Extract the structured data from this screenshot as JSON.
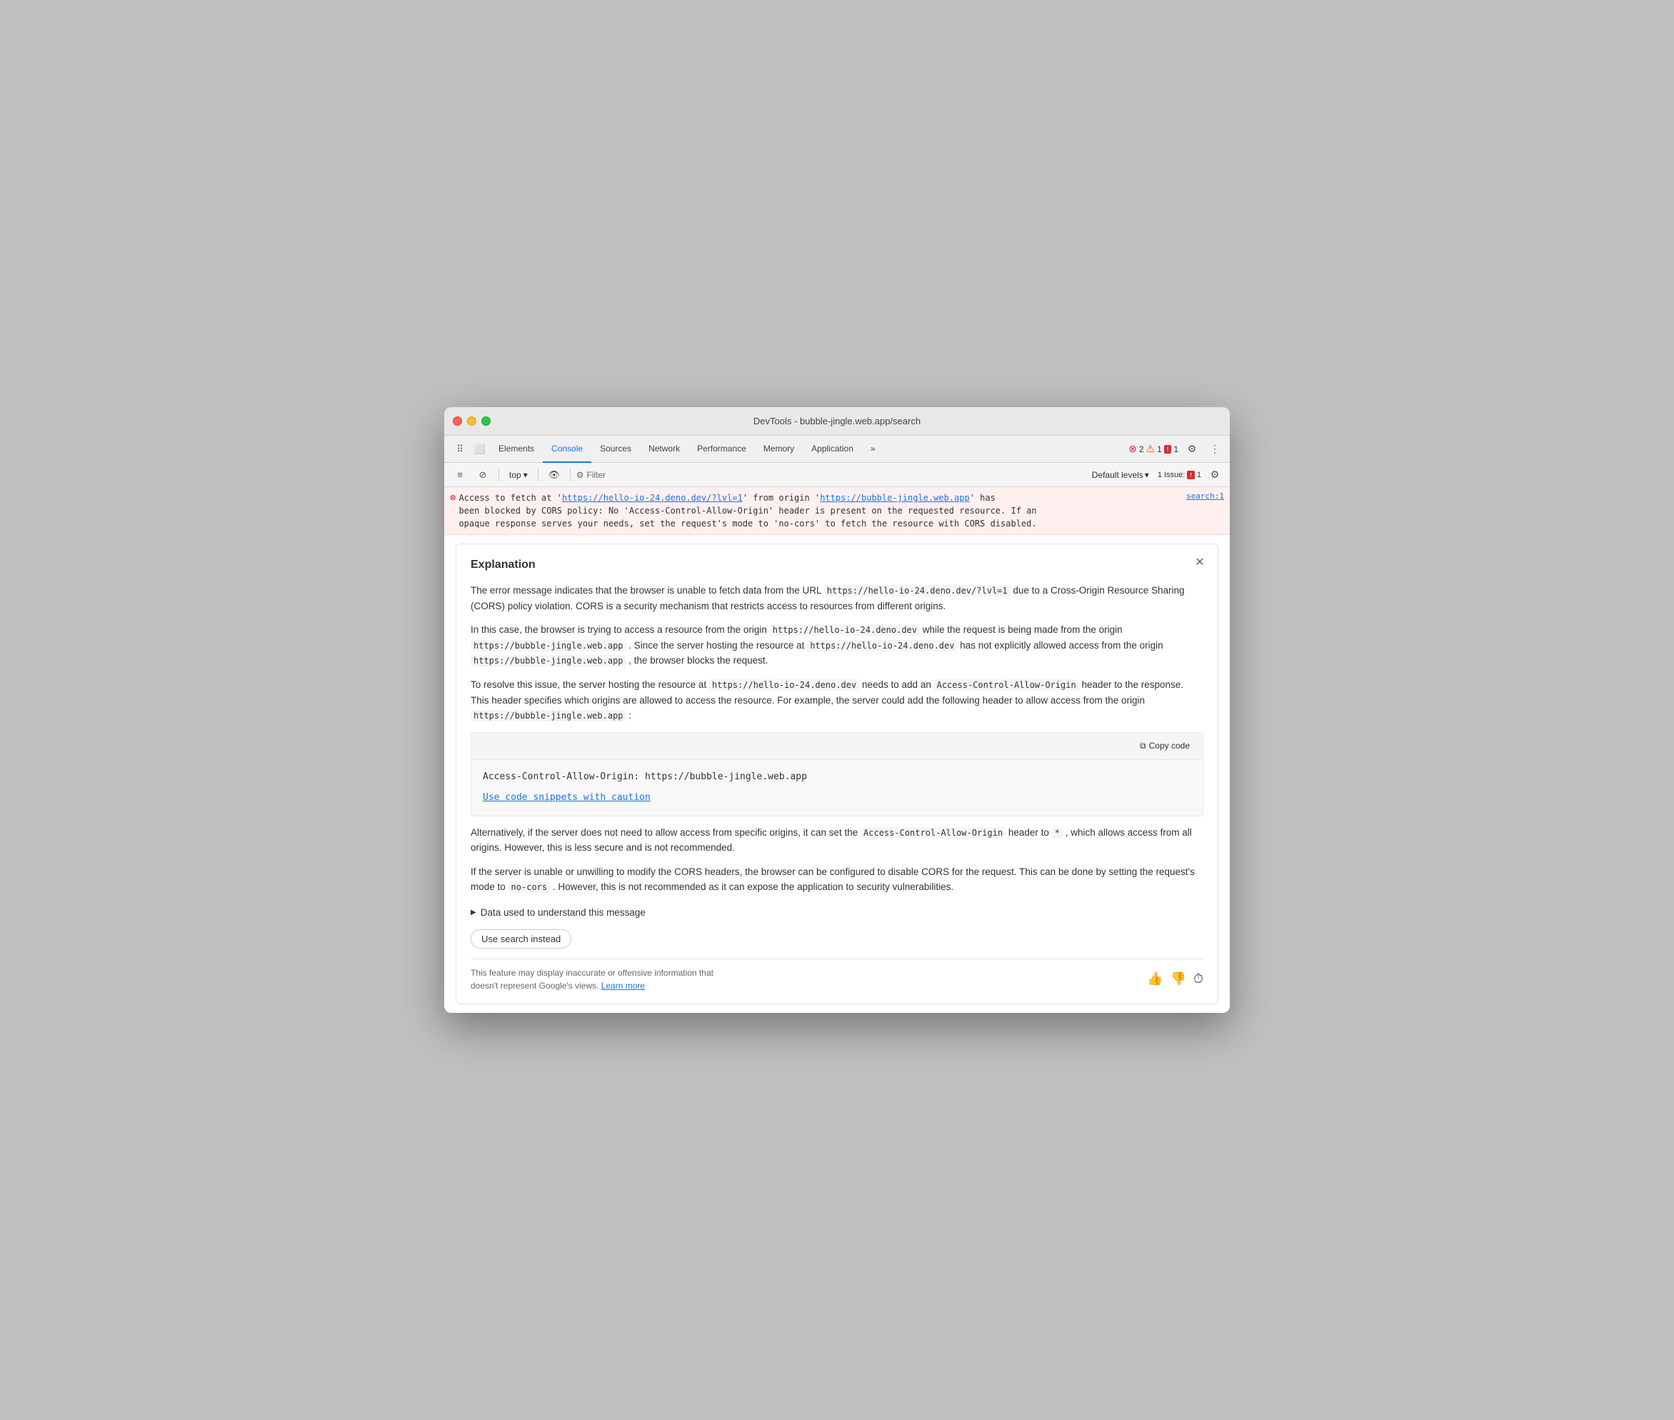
{
  "titlebar": {
    "title": "DevTools - bubble-jingle.web.app/search"
  },
  "tabs": {
    "items": [
      {
        "label": "Elements",
        "active": false
      },
      {
        "label": "Console",
        "active": true
      },
      {
        "label": "Sources",
        "active": false
      },
      {
        "label": "Network",
        "active": false
      },
      {
        "label": "Performance",
        "active": false
      },
      {
        "label": "Memory",
        "active": false
      },
      {
        "label": "Application",
        "active": false
      }
    ],
    "more_label": "»",
    "error_count": "2",
    "warning_count": "1",
    "issue_count": "1"
  },
  "toolbar": {
    "top_label": "top",
    "filter_label": "Filter",
    "default_levels_label": "Default levels",
    "default_levels_arrow": "▾",
    "issues_label": "1 Issue:",
    "issues_count": "1"
  },
  "console": {
    "error_message": "Access to fetch at 'https://hello-io-24.deno.dev/?lvl=1' from origin 'https://bubble-jingle.web.app' has been blocked by CORS policy: No 'Access-Control-Allow-Origin' header is present on the requested resource. If an opaque response serves your needs, set the request's mode to 'no-cors' to fetch the resource with CORS disabled.",
    "fetch_url": "https://hello-io-24.deno.dev/?lvl=1",
    "origin_url": "https://bubble-jingle.web.app",
    "source_ref": "search:1"
  },
  "explanation": {
    "title": "Explanation",
    "para1": "The error message indicates that the browser is unable to fetch data from the URL",
    "url1": "https://hello-io-24.deno.dev/?lvl=1",
    "para1_cont": "due to a Cross-Origin Resource Sharing (CORS) policy violation. CORS is a security mechanism that restricts access to resources from different origins.",
    "para2_1": "In this case, the browser is trying to access a resource from the origin",
    "url2": "https://hello-io-24.deno.dev",
    "para2_2": "while the request is being made from the origin",
    "url3": "https://bubble-jingle.web.app",
    "para2_3": ". Since the server hosting the resource at",
    "url4": "https://hello-io-24.deno.dev",
    "para2_4": "has not explicitly allowed access from the origin",
    "url5": "https://bubble-jingle.web.app",
    "para2_5": ", the browser blocks the request.",
    "para3_1": "To resolve this issue, the server hosting the resource at",
    "url6": "https://hello-io-24.deno.dev",
    "para3_2": "needs to add an",
    "code1": "Access-Control-Allow-Origin",
    "para3_3": "header to the response. This header specifies which origins are allowed to access the resource. For example, the server could add the following header to allow access from the origin",
    "url7": "https://bubble-jingle.web.app",
    "para3_4": ":",
    "code_block": "Access-Control-Allow-Origin: https://bubble-jingle.web.app",
    "copy_code_label": "Copy code",
    "caution_label": "Use code snippets with caution",
    "para4_1": "Alternatively, if the server does not need to allow access from specific origins, it can set the",
    "code2": "Access-Control-Allow-Origin",
    "para4_2": "header to",
    "code3": "*",
    "para4_3": ", which allows access from all origins. However, this is less secure and is not recommended.",
    "para5_1": "If the server is unable or unwilling to modify the CORS headers, the browser can be configured to disable CORS for the request. This can be done by setting the request's mode to",
    "code4": "no-cors",
    "para5_2": ". However, this is not recommended as it can expose the application to security vulnerabilities.",
    "data_used_label": "Data used to understand this message",
    "use_search_label": "Use search instead",
    "disclaimer_text": "This feature may display inaccurate or offensive information that doesn't represent Google's views.",
    "learn_more_label": "Learn more"
  }
}
